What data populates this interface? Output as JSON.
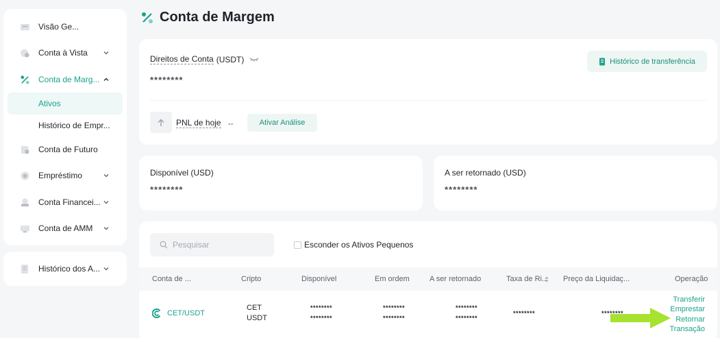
{
  "sidebar": {
    "items": [
      {
        "label": "Visão Ge...",
        "icon": "overview-icon",
        "chevron": ""
      },
      {
        "label": "Conta à Vista",
        "icon": "spot-account-icon",
        "chevron": "down"
      },
      {
        "label": "Conta de Marg...",
        "icon": "margin-icon",
        "chevron": "up",
        "active": true
      },
      {
        "label": "Conta de Futuro",
        "icon": "futures-icon",
        "chevron": ""
      },
      {
        "label": "Empréstimo",
        "icon": "loan-icon",
        "chevron": "down"
      },
      {
        "label": "Conta Financei...",
        "icon": "finance-icon",
        "chevron": "down"
      },
      {
        "label": "Conta de AMM",
        "icon": "amm-icon",
        "chevron": "down"
      }
    ],
    "sub_items": [
      {
        "label": "Ativos",
        "selected": true
      },
      {
        "label": "Histórico de Empr...",
        "selected": false
      }
    ],
    "bottom_item": {
      "label": "Histórico dos A...",
      "icon": "history-icon",
      "chevron": "down"
    }
  },
  "header": {
    "title": "Conta de Margem",
    "icon": "margin-icon"
  },
  "account": {
    "rights_label": "Direitos de Conta",
    "rights_unit": "(USDT)",
    "rights_value": "********",
    "history_button": "Histórico de transferência",
    "pnl_label": "PNL de hoje",
    "pnl_value": "--",
    "analyse_button": "Ativar Análise"
  },
  "available": {
    "label": "Disponível (USD)",
    "value": "********"
  },
  "to_return": {
    "label": "A ser retornado (USD)",
    "value": "********"
  },
  "assets": {
    "search_placeholder": "Pesquisar",
    "hide_small_label": "Esconder os Ativos Pequenos",
    "columns": [
      "Conta de ...",
      "Cripto",
      "Disponível",
      "Em ordem",
      "A ser retornado",
      "Taxa de Ri...",
      "Preço da Liquidaç...",
      "Operação"
    ],
    "rows": [
      {
        "account": "CET/USDT",
        "crypto": [
          "CET",
          "USDT"
        ],
        "available": [
          "********",
          "********"
        ],
        "in_order": [
          "********",
          "********"
        ],
        "to_return": [
          "********",
          "********"
        ],
        "risk_rate": "********",
        "liquidation_price": "********",
        "operations": [
          "Transferir",
          "Emprestar",
          "Retornar",
          "Transação"
        ]
      }
    ]
  },
  "colors": {
    "accent": "#1aa38a",
    "annotation_arrow": "#a6e22e"
  }
}
